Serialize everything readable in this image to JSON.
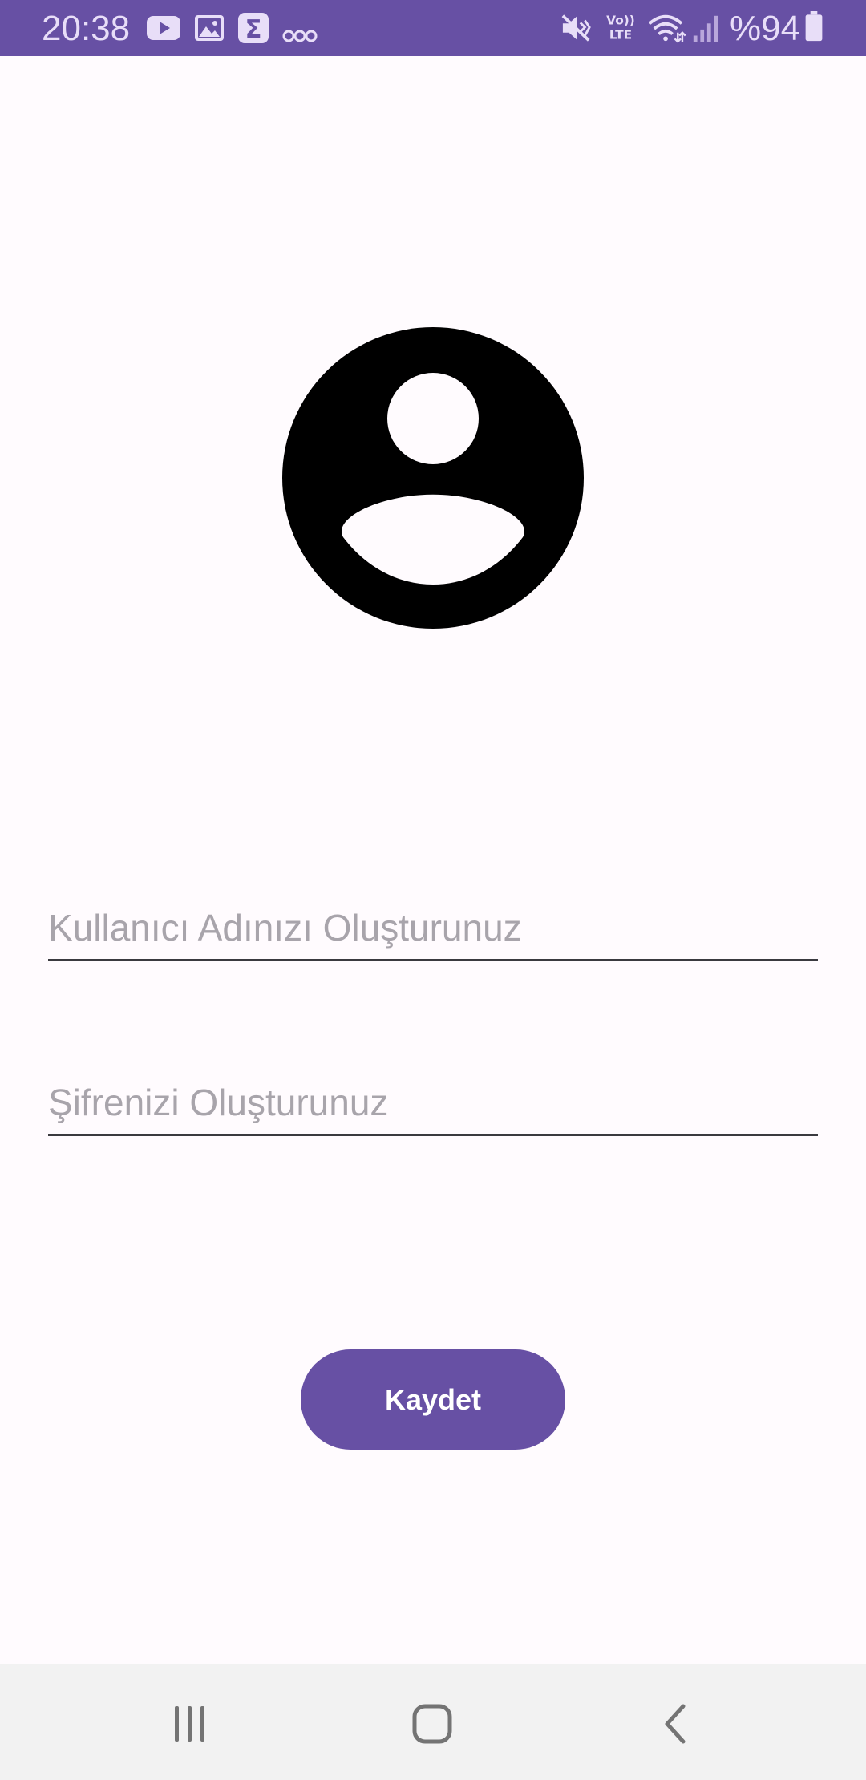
{
  "status_bar": {
    "time": "20:38",
    "battery": "%94",
    "icons": [
      "youtube-icon",
      "gallery-icon",
      "sigma-app-icon",
      "voicemail-icon",
      "mute-icon",
      "volte-icon",
      "wifi-icon",
      "signal-icon",
      "battery-icon"
    ],
    "volte_label": "Vo)) LTE"
  },
  "avatar": {
    "icon": "account-circle-icon"
  },
  "form": {
    "username": {
      "value": "",
      "placeholder": "Kullanıcı Adınızı Oluşturunuz"
    },
    "password": {
      "value": "",
      "placeholder": "Şifrenizi Oluşturunuz"
    },
    "save_label": "Kaydet"
  },
  "nav_bar": {
    "buttons": [
      "recents-icon",
      "home-icon",
      "back-icon"
    ]
  },
  "colors": {
    "accent": "#6750a4",
    "background": "#fffbfe",
    "status_text": "#e8def8",
    "placeholder": "#a8a4ab",
    "nav_background": "#f2f2f2"
  }
}
